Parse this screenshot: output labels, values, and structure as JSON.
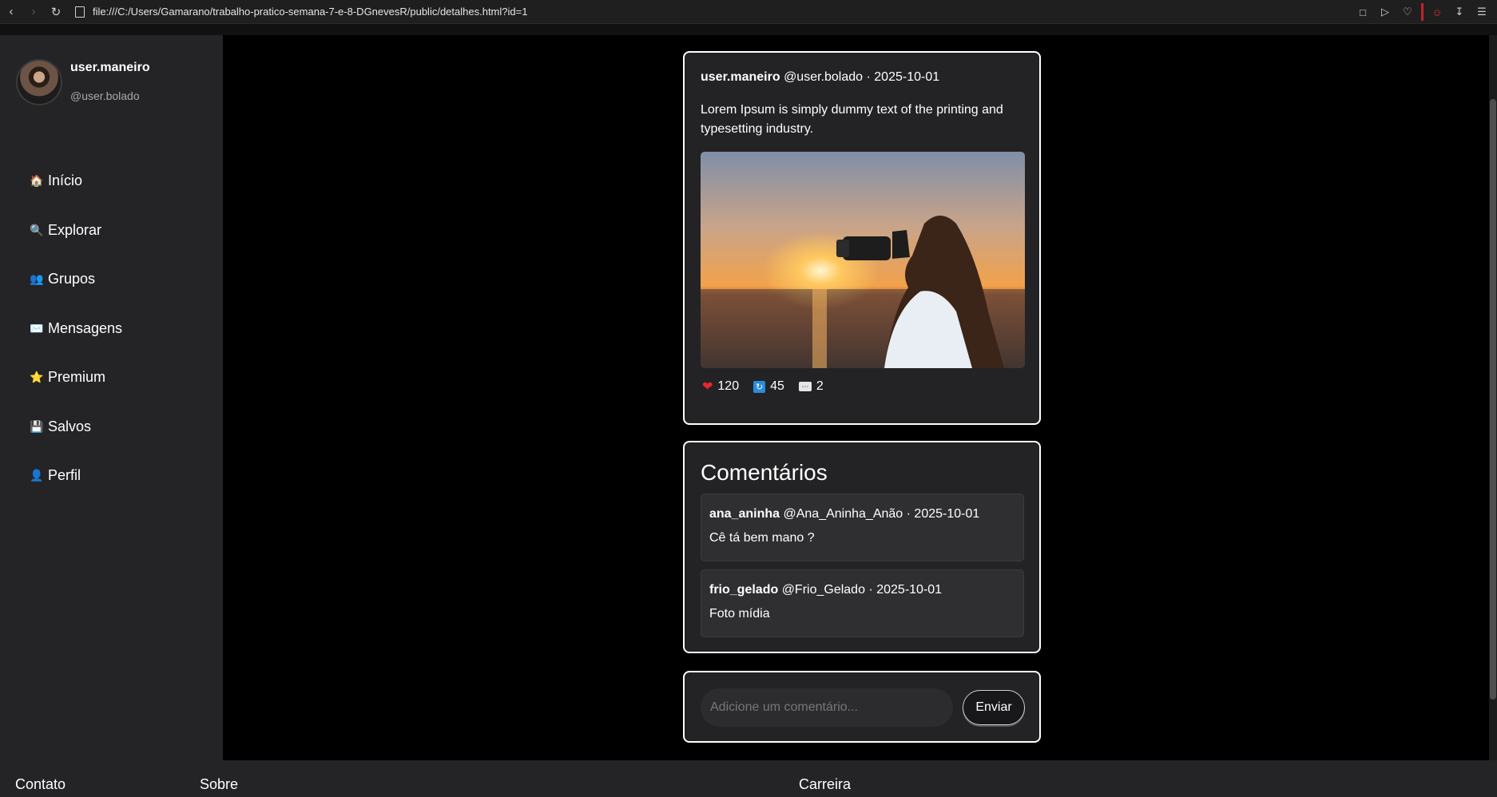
{
  "browser": {
    "url": "file:///C:/Users/Gamarano/trabalho-pratico-semana-7-e-8-DGnevesR/public/detalhes.html?id=1"
  },
  "sidebar": {
    "user_name": "user.maneiro",
    "user_handle": "@user.bolado",
    "items": [
      {
        "label": "Início",
        "icon": "house-icon",
        "glyph": "🏠"
      },
      {
        "label": "Explorar",
        "icon": "magnifier-icon",
        "glyph": "🔍"
      },
      {
        "label": "Grupos",
        "icon": "people-icon",
        "glyph": "👥"
      },
      {
        "label": "Mensagens",
        "icon": "envelope-icon",
        "glyph": "✉️"
      },
      {
        "label": "Premium",
        "icon": "star-icon",
        "glyph": "⭐"
      },
      {
        "label": "Salvos",
        "icon": "floppy-disk-icon",
        "glyph": "💾"
      },
      {
        "label": "Perfil",
        "icon": "person-icon",
        "glyph": "👤"
      }
    ]
  },
  "post": {
    "author_name": "user.maneiro",
    "author_handle": "@user.bolado",
    "date_sep": "·",
    "date": "2025-10-01",
    "text": "Lorem Ipsum is simply dummy text of the printing and typesetting industry.",
    "likes": "120",
    "reposts": "45",
    "comments": "2"
  },
  "comments": {
    "title": "Comentários",
    "items": [
      {
        "name": "ana_aninha",
        "handle": "@Ana_Aninha_Anão",
        "date": "2025-10-01",
        "text": "Cê tá bem mano ?"
      },
      {
        "name": "frio_gelado",
        "handle": "@Frio_Gelado",
        "date": "2025-10-01",
        "text": "Foto mídia"
      }
    ]
  },
  "compose": {
    "placeholder": "Adicione um comentário...",
    "send_label": "Enviar"
  },
  "footer": {
    "contact": "Contato",
    "about": "Sobre",
    "careers": "Carreira"
  },
  "colors": {
    "sidebar_bg": "#242426",
    "card_bg": "#232325",
    "like": "#e8262e",
    "repost": "#2a8bd8"
  }
}
